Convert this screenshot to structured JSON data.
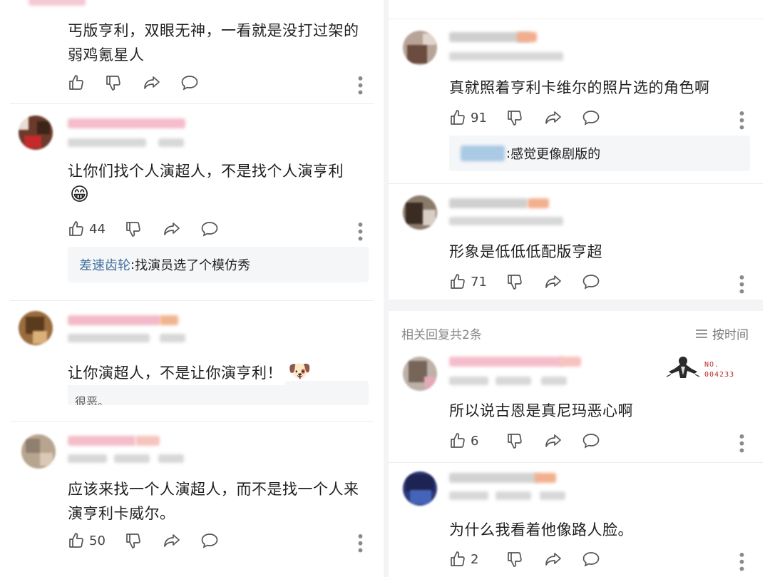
{
  "left": {
    "comments": [
      {
        "text_lines": [
          "丐版亨利，双眼无神，一看就是没打过架的",
          "弱鸡氪星人"
        ],
        "likes": ""
      },
      {
        "text_lines": [
          "让你们找个人演超人，不是找个人演亨利"
        ],
        "emoji": "😁",
        "likes": "44",
        "reply": {
          "name": "差速齿轮",
          "sep": ": ",
          "text": "找演员选了个模仿秀"
        }
      },
      {
        "text_lines": [
          "让你演超人，不是让你演亨利！"
        ],
        "emoji": "🐶",
        "overlap_text": "很恶。",
        "likes": ""
      },
      {
        "text_lines": [
          "应该来找一个人演超人，而不是找一个人来",
          "演亨利卡威尔。"
        ],
        "likes": "50"
      }
    ]
  },
  "right": {
    "comments": [
      {
        "text_lines": [
          "真就照着亨利卡维尔的照片选的角色啊"
        ],
        "likes": "91",
        "reply": {
          "sep": ": ",
          "text": "感觉更像剧版的"
        }
      },
      {
        "text_lines": [
          "形象是低低低配版亨超"
        ],
        "likes": "71"
      }
    ],
    "related_label": "相关回复共2条",
    "sort_label": "按时间",
    "replies": [
      {
        "text_lines": [
          "所以说古恩是真尼玛恶心啊"
        ],
        "likes": "6",
        "badge": [
          "NO.",
          "004233"
        ]
      },
      {
        "text_lines": [
          "为什么我看着他像路人脸。"
        ],
        "likes": "2"
      }
    ]
  },
  "colors": {
    "reply_name": "#3f6f9c",
    "background": "#ffffff",
    "gutter": "#f4f4f6",
    "panel": "#f5f6f8"
  },
  "icons": [
    "thumb-up-icon",
    "thumb-down-icon",
    "share-icon",
    "comment-icon",
    "more-vertical-icon",
    "sort-lines-icon"
  ]
}
